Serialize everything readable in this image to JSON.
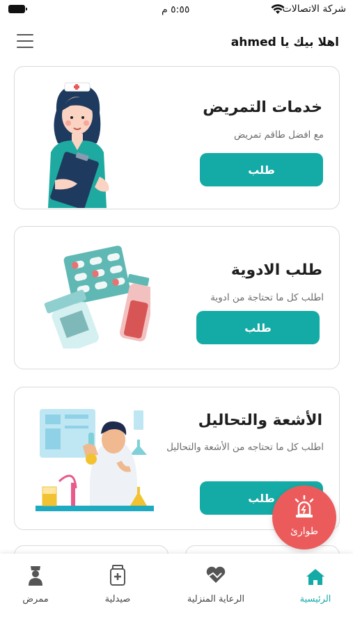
{
  "status_bar": {
    "time": "٥:٥٥ م",
    "carrier": "شركة الاتصالات"
  },
  "header": {
    "greeting": "اهلا بيك يا ahmed"
  },
  "services": [
    {
      "title": "خدمات التمريض",
      "subtitle": "مع افضل طاقم تمريض",
      "button": "طلب",
      "illustration": "nurse-illustration"
    },
    {
      "title": "طلب الادوية",
      "subtitle": "اطلب كل ما تحتاجة من ادوية",
      "button": "طلب",
      "illustration": "medicine-illustration"
    },
    {
      "title": "الأشعة والتحاليل",
      "subtitle": "اطلب كل ما تحتاجه من الأشعة والتحاليل",
      "button": "طلب",
      "illustration": "lab-illustration"
    }
  ],
  "emergency": {
    "label": "طوارئ",
    "icon": "siren-icon",
    "color": "#ec5b5b"
  },
  "bottom_nav": [
    {
      "label": "الرئيسية",
      "icon": "home-icon",
      "active": true
    },
    {
      "label": "الرعاية المنزلية",
      "icon": "heart-hands-icon",
      "active": false
    },
    {
      "label": "صيدلية",
      "icon": "medicine-bottle-icon",
      "active": false
    },
    {
      "label": "ممرض",
      "icon": "nurse-icon",
      "active": false
    }
  ],
  "colors": {
    "accent": "#14aaa5",
    "emergency": "#ec5b5b",
    "border": "#d9d9d9"
  }
}
